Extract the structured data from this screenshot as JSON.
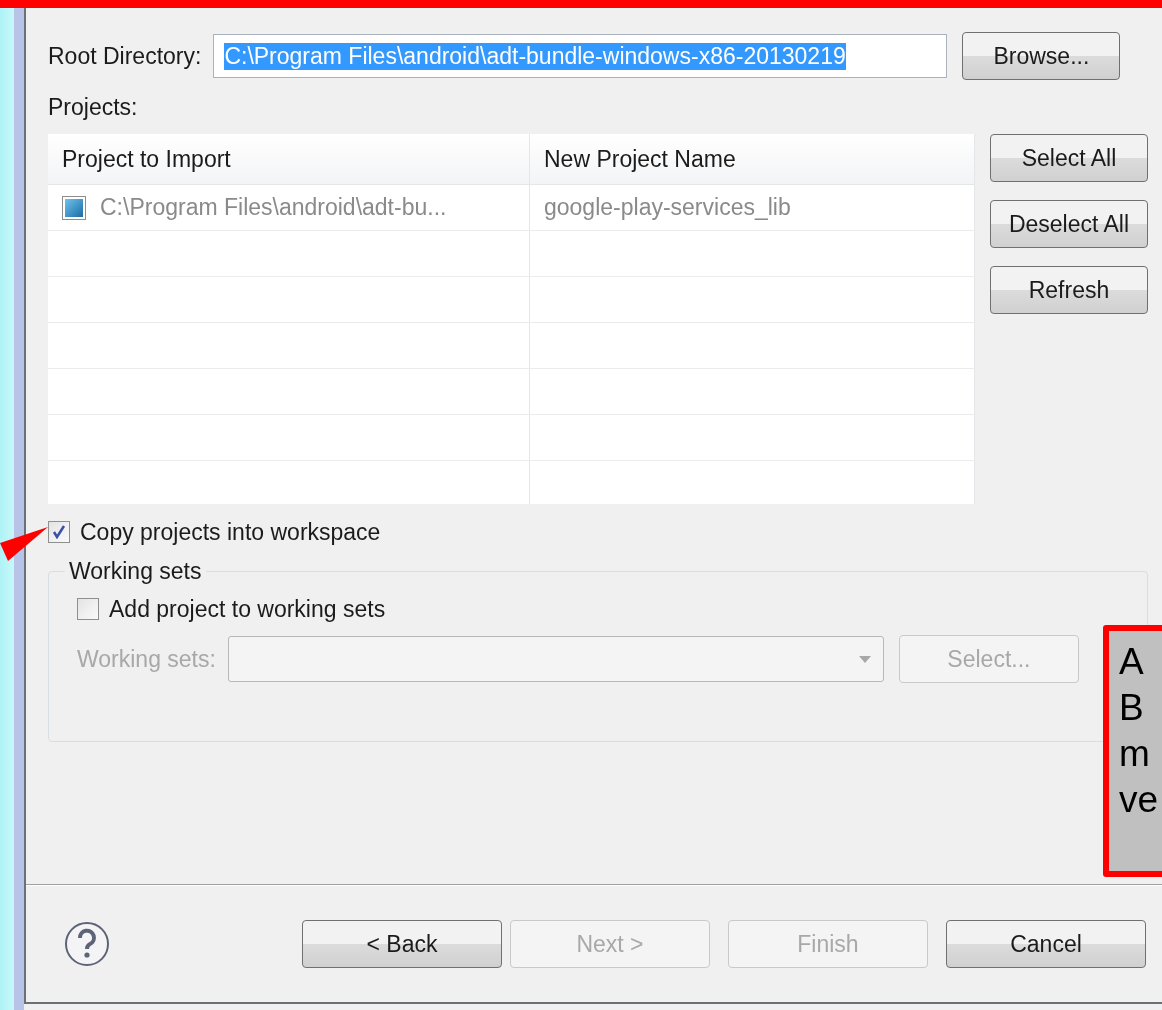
{
  "root_directory": {
    "label": "Root Directory:",
    "value": "C:\\Program Files\\android\\adt-bundle-windows-x86-20130219",
    "text_selected": true
  },
  "browse_button": "Browse...",
  "projects_label": "Projects:",
  "table": {
    "columns": [
      "Project to Import",
      "New Project Name"
    ],
    "rows": [
      {
        "checked": true,
        "project": "C:\\Program Files\\android\\adt-bu...",
        "name": "google-play-services_lib"
      }
    ]
  },
  "side_buttons": [
    "Select All",
    "Deselect All",
    "Refresh"
  ],
  "copy_projects": {
    "label": "Copy projects into workspace",
    "checked": true
  },
  "working_sets_group": {
    "title": "Working sets",
    "add_to_sets": {
      "label": "Add project to working sets",
      "checked": false
    },
    "field_label": "Working sets:",
    "disabled": true,
    "select_button": "Select..."
  },
  "nav_buttons": [
    {
      "label": "< Back",
      "disabled": false
    },
    {
      "label": "Next >",
      "disabled": true
    },
    {
      "label": "Finish",
      "disabled": true
    },
    {
      "label": "Cancel",
      "disabled": false
    }
  ],
  "callout": {
    "lines": [
      "A",
      "B",
      "m",
      "ve"
    ]
  }
}
